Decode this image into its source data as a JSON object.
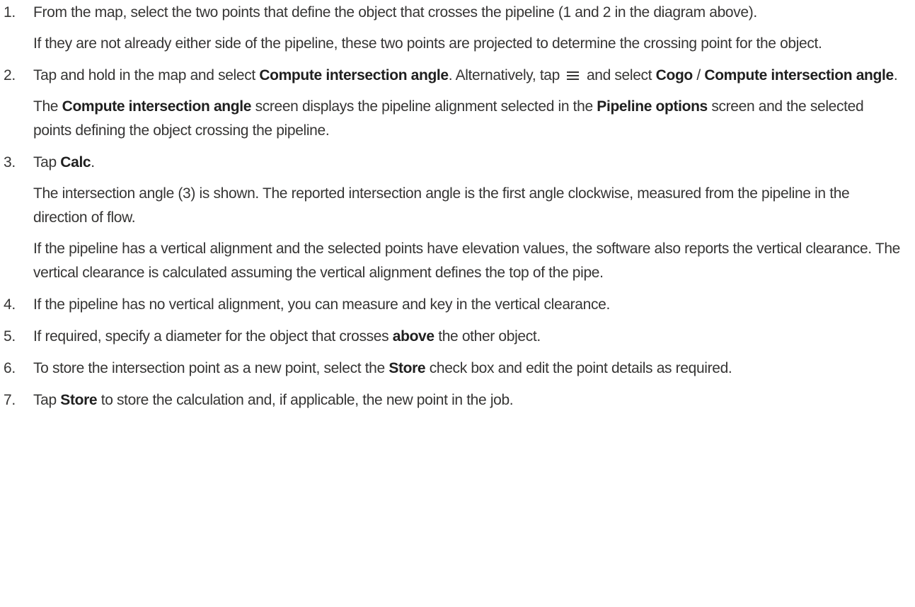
{
  "steps": [
    {
      "number": "1.",
      "paragraphs": [
        [
          "From the map, select the two points that define the object that crosses the pipeline (1 and 2 in the diagram above)."
        ],
        [
          "If they are not already either side of the pipeline, these two points are projected to determine the crossing point for the object."
        ]
      ]
    },
    {
      "number": "2.",
      "p1": {
        "a": "Tap and hold in the map and select ",
        "b": "Compute intersection angle",
        "c": ". Alternatively, tap ",
        "d": " and select ",
        "e": "Cogo",
        "f": " / ",
        "g": "Compute intersection angle",
        "h": "."
      },
      "menu_icon": "hamburger-menu-icon",
      "p2": {
        "a": "The ",
        "b": "Compute intersection angle",
        "c": " screen displays the pipeline alignment selected in the ",
        "d": "Pipeline options",
        "e": " screen and the selected points defining the object crossing the pipeline."
      }
    },
    {
      "number": "3.",
      "p1": {
        "a": "Tap ",
        "b": "Calc",
        "c": "."
      },
      "p2": "The intersection angle (3) is shown. The reported intersection angle is the first angle clockwise, measured from the pipeline in the direction of flow.",
      "p3": "If the pipeline has a vertical alignment and the selected points have elevation values, the software also reports the vertical clearance. The vertical clearance is calculated assuming the vertical alignment defines the top of the pipe."
    },
    {
      "number": "4.",
      "text": "If the pipeline has no vertical alignment, you can measure and key in the vertical clearance."
    },
    {
      "number": "5.",
      "a": "If required, specify a diameter for the object that crosses ",
      "b": "above",
      "c": " the other object."
    },
    {
      "number": "6.",
      "a": "To store the intersection point as a new point, select the ",
      "b": "Store",
      "c": " check box and edit the point details as required."
    },
    {
      "number": "7.",
      "a": "Tap ",
      "b": "Store",
      "c": " to store the calculation and, if applicable, the new point in the job."
    }
  ]
}
